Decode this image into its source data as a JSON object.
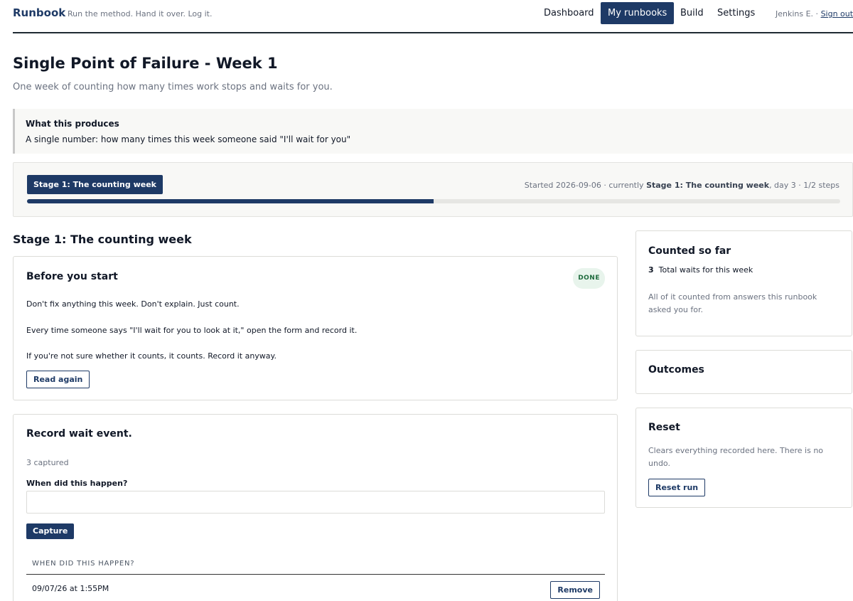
{
  "header": {
    "brand": "Runbook",
    "tagline": "Run the method. Hand it over. Log it.",
    "nav": [
      {
        "label": "Dashboard",
        "active": false
      },
      {
        "label": "My runbooks",
        "active": true
      },
      {
        "label": "Build",
        "active": false
      },
      {
        "label": "Settings",
        "active": false
      }
    ],
    "user_name": "Jenkins E. ·",
    "sign_out": "Sign out"
  },
  "page": {
    "title": "Single Point of Failure - Week 1",
    "subtitle": "One week of counting how many times work stops and waits for you."
  },
  "produces": {
    "heading": "What this produces",
    "text": "A single number: how many times this week someone said \"I'll wait for you\""
  },
  "stage": {
    "pill": "Stage 1: The counting week",
    "meta_prefix": "Started 2026-09-06 · currently",
    "meta_stage": "Stage 1: The counting week",
    "meta_suffix": ", day 3 · 1/2 steps",
    "progress_fraction": 0.5
  },
  "section_title": "Stage 1: The counting week",
  "before": {
    "title": "Before you start",
    "badge": "DONE",
    "lines": [
      "Don't fix anything this week. Don't explain. Just count.",
      "Every time someone says \"I'll wait for you to look at it,\" open the form and record it.",
      "If you're not sure whether it counts, it counts. Record it anyway."
    ],
    "button": "Read again"
  },
  "record": {
    "title": "Record wait event.",
    "captured": "3 captured",
    "field_label": "When did this happen?",
    "field_value": "",
    "capture_button": "Capture",
    "table_header": "WHEN DID THIS HAPPEN?",
    "rows": [
      {
        "value": "09/07/26 at 1:55PM",
        "action": "Remove"
      }
    ]
  },
  "sidebar": {
    "counted": {
      "title": "Counted so far",
      "count": "3",
      "count_label": "Total waits for this week",
      "note": "All of it counted from answers this runbook asked you for."
    },
    "outcomes": {
      "title": "Outcomes"
    },
    "reset": {
      "title": "Reset",
      "note": "Clears everything recorded here. There is no undo.",
      "button": "Reset run"
    }
  }
}
